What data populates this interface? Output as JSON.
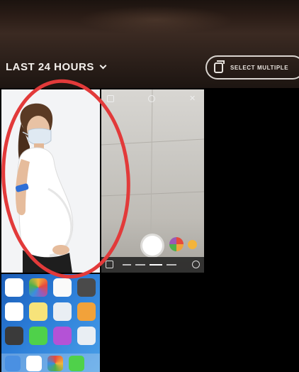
{
  "header": {
    "time_filter_label": "LAST 24 HOURS",
    "select_multiple_label": "SELECT MULTIPLE"
  },
  "grid": {
    "items": [
      {
        "name": "photo-pregnant-woman-mask",
        "kind": "photo"
      },
      {
        "name": "photo-camera-screenshot",
        "kind": "screenshot"
      },
      {
        "name": "empty-slot",
        "kind": "empty"
      },
      {
        "name": "photo-iphone-home-screen",
        "kind": "screenshot"
      },
      {
        "name": "empty-slot",
        "kind": "empty"
      },
      {
        "name": "empty-slot",
        "kind": "empty"
      }
    ]
  },
  "annotation": {
    "shape": "ellipse",
    "color": "#e23a3a",
    "target": "photo-pregnant-woman-mask"
  },
  "colors": {
    "header_bg": "#2f221c",
    "text": "#f4f0ec",
    "grid_bg": "#000000"
  }
}
